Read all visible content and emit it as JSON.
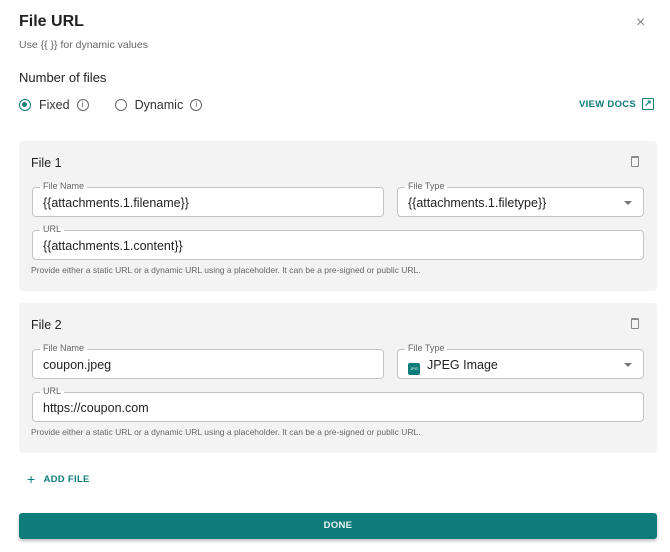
{
  "header": {
    "title": "File URL",
    "subtitle": "Use {{ }} for dynamic values",
    "close": "×"
  },
  "number_of_files": {
    "label": "Number of files",
    "options": [
      {
        "label": "Fixed",
        "selected": true
      },
      {
        "label": "Dynamic",
        "selected": false
      }
    ],
    "info": "i"
  },
  "view_docs": {
    "label": "VIEW DOCS",
    "icon": "↗"
  },
  "files": [
    {
      "title": "File 1",
      "file_name_label": "File Name",
      "file_name": "{{attachments.1.filename}}",
      "file_type_label": "File Type",
      "file_type": "{{attachments.1.filetype}}",
      "url_label": "URL",
      "url": "{{attachments.1.content}}",
      "help": "Provide either a static URL or a dynamic URL using a placeholder. It can be a pre-signed or public URL."
    },
    {
      "title": "File 2",
      "file_name_label": "File Name",
      "file_name": "coupon.jpeg",
      "file_type_label": "File Type",
      "file_type": "JPEG Image",
      "file_type_icon": "JPG",
      "url_label": "URL",
      "url": "https://coupon.com",
      "help": "Provide either a static URL or a dynamic URL using a placeholder. It can be a pre-signed or public URL."
    }
  ],
  "add_file": {
    "icon": "+",
    "label": "ADD FILE"
  },
  "done": "DONE",
  "colors": {
    "accent": "#0e7c7b",
    "card": "#f3f3f3"
  }
}
